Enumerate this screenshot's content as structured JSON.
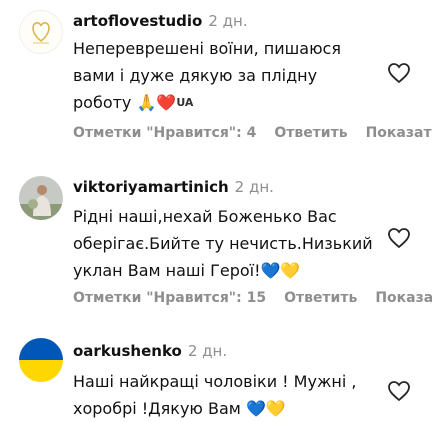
{
  "comments": [
    {
      "username": "artoflovestudio",
      "time": "2 дн.",
      "lines": [
        "Непереврешені воїни, пишаюся",
        "вами і дуже дякую за плідну",
        "роботу"
      ],
      "emoji": [
        "🙏",
        "❤️",
        "UA"
      ],
      "likes_label": "Отметки \"Нравится\": 4",
      "reply_label": "Ответить",
      "more_label": "Показать"
    },
    {
      "username": "viktoriyamartinich",
      "time": "2 дн.",
      "lines": [
        "Рідні наші,нехай Боженько Вас",
        "оберігає.Бийте ту нечисть.Низький",
        "уклан Вам наші Герої!"
      ],
      "emoji": [
        "💙",
        "💛"
      ],
      "likes_label": "Отметки \"Нравится\": 15",
      "reply_label": "Ответить",
      "more_label": "Показать"
    },
    {
      "username": "oarkushenko",
      "time": "2 дн.",
      "lines": [
        "Наші найкращі чоловіки ! Мужні ,",
        "хоробрі !Дякую Вам"
      ],
      "emoji": [
        "💙",
        "💛"
      ]
    }
  ]
}
